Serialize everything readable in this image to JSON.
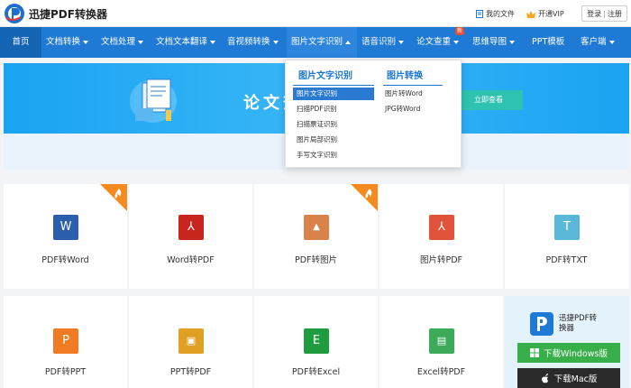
{
  "header": {
    "brand": "迅捷PDF转换器",
    "my_docs": "我的文件",
    "vip": "开通VIP",
    "login": "登录",
    "separator": "|",
    "register": "注册"
  },
  "nav": {
    "items": [
      {
        "label": "首页"
      },
      {
        "label": "文档转换"
      },
      {
        "label": "文档处理"
      },
      {
        "label": "文档文本翻译"
      },
      {
        "label": "音视频转换"
      },
      {
        "label": "图片文字识别"
      },
      {
        "label": "语音识别"
      },
      {
        "label": "论文查重"
      },
      {
        "label": "思维导图"
      },
      {
        "label": "PPT模板"
      },
      {
        "label": "客户端"
      }
    ],
    "new_badge": "新"
  },
  "banner": {
    "title": "论文查",
    "button": "立即查看"
  },
  "dropdown": {
    "col1": {
      "heading": "图片文字识别",
      "items": [
        "图片文字识别",
        "扫描PDF识别",
        "扫描票证识别",
        "图片局部识别",
        "手写文字识别"
      ]
    },
    "col2": {
      "heading": "图片转换",
      "items": [
        "图片转Word",
        "JPG转Word"
      ]
    }
  },
  "tools": {
    "row1": [
      {
        "label": "PDF转Word",
        "icon": "word-icon",
        "color": "#2b5fae",
        "glyph": "W",
        "hot": true
      },
      {
        "label": "Word转PDF",
        "icon": "pdf-icon",
        "color": "#c8261e",
        "glyph": "⅄",
        "hot": false
      },
      {
        "label": "PDF转图片",
        "icon": "image-icon",
        "color": "#d9834a",
        "glyph": "▲",
        "hot": true
      },
      {
        "label": "图片转PDF",
        "icon": "pdf-icon",
        "color": "#e0533a",
        "glyph": "⅄",
        "hot": false
      },
      {
        "label": "PDF转TXT",
        "icon": "txt-icon",
        "color": "#5ab7d8",
        "glyph": "T",
        "hot": false
      }
    ],
    "row2": [
      {
        "label": "PDF转PPT",
        "icon": "ppt-icon",
        "color": "#f07b22",
        "glyph": "P"
      },
      {
        "label": "PPT转PDF",
        "icon": "ppt-pdf-icon",
        "color": "#e0a024",
        "glyph": "▣"
      },
      {
        "label": "PDF转Excel",
        "icon": "excel-icon",
        "color": "#1f9d3e",
        "glyph": "E"
      },
      {
        "label": "Excel转PDF",
        "icon": "excel-pdf-icon",
        "color": "#3daa5a",
        "glyph": "▤"
      }
    ]
  },
  "promo": {
    "name_line1": "迅捷PDF转",
    "name_line2": "换器",
    "win_button": "下载Windows版",
    "mac_button": "下载Mac版"
  }
}
